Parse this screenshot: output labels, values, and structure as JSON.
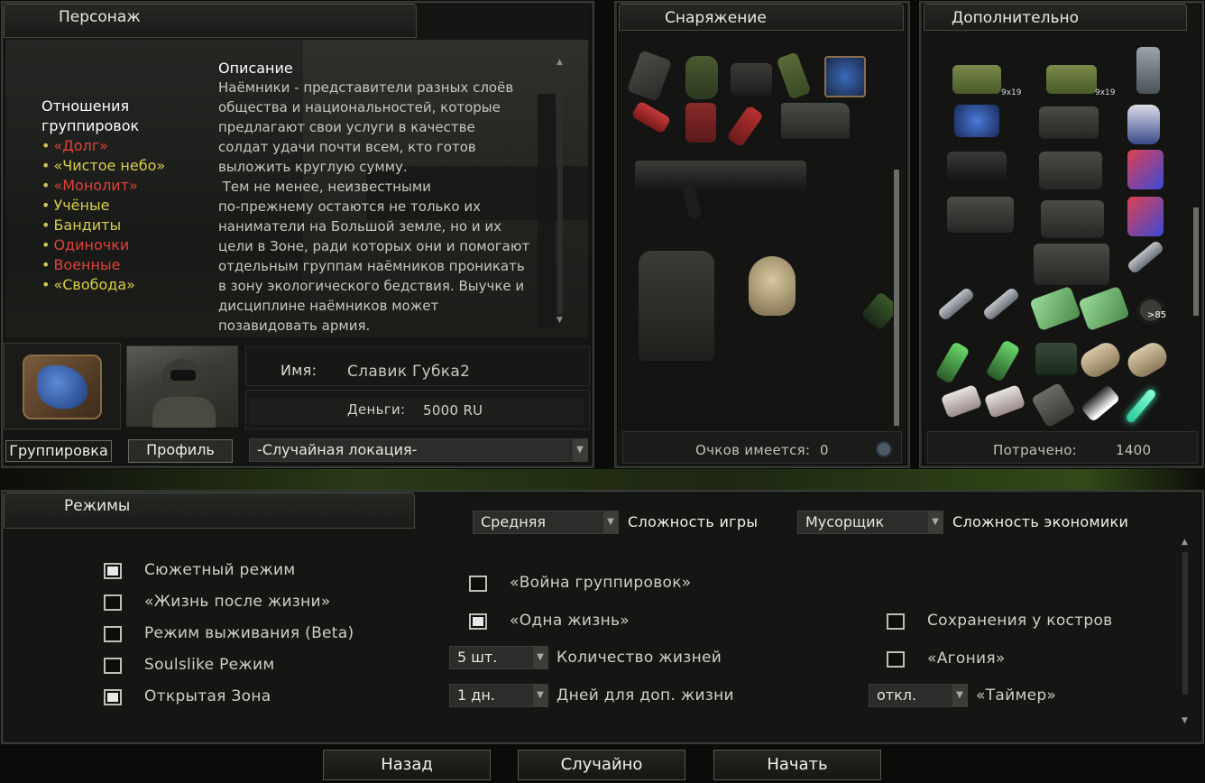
{
  "character": {
    "tab": "Персонаж",
    "relations_title": "Отношения группировок",
    "factions": [
      {
        "name": "«Долг»",
        "color": "#e0413a"
      },
      {
        "name": "«Чистое небо»",
        "color": "#d8cd48"
      },
      {
        "name": "«Монолит»",
        "color": "#e0413a"
      },
      {
        "name": "Учёные",
        "color": "#d8cd48"
      },
      {
        "name": "Бандиты",
        "color": "#d8cd48"
      },
      {
        "name": "Одиночки",
        "color": "#e0413a"
      },
      {
        "name": "Военные",
        "color": "#e0413a"
      },
      {
        "name": "«Свобода»",
        "color": "#d8cd48"
      }
    ],
    "description_title": "Описание",
    "description_lines": [
      "Наёмники - представители разных слоёв",
      "общества и национальностей, которые",
      "предлагают свои услуги в качестве",
      "солдат удачи почти всем, кто готов",
      "выложить круглую сумму.",
      " Тем не менее, неизвестными",
      "по-прежнему остаются не только их",
      "наниматели на Большой земле, но и их",
      "цели в Зоне, ради которых они и помогают",
      "отдельным группам наёмников проникать",
      "в зону экологического бедствия. Выучке и",
      "дисциплине наёмников может",
      "позавидовать армия."
    ],
    "name_label": "Имя:",
    "name_value": "Славик Губка2",
    "money_label": "Деньги:",
    "money_value": "5000 RU",
    "btn_faction": "Группировка",
    "btn_profile": "Профиль",
    "location": "-Случайная локация-"
  },
  "equipment": {
    "tab": "Снаряжение",
    "points_label": "Очков имеется:",
    "points_value": "0"
  },
  "extra": {
    "tab": "Дополнительно",
    "spent_label": "Потрачено:",
    "spent_value": "1400",
    "ammo_label": "9x19",
    "count_label": ">85"
  },
  "modes": {
    "tab": "Режимы",
    "difficulty_value": "Средняя",
    "difficulty_label": "Сложность игры",
    "economy_value": "Мусорщик",
    "economy_label": "Сложность экономики",
    "story_mode": {
      "label": "Сюжетный режим",
      "checked": true
    },
    "life_after": {
      "label": "«Жизнь после жизни»",
      "checked": false
    },
    "survival": {
      "label": "Режим выживания (Beta)",
      "checked": false
    },
    "soulslike": {
      "label": "Soulslike Режим",
      "checked": false
    },
    "open_zone": {
      "label": "Открытая Зона",
      "checked": true
    },
    "faction_war": {
      "label": "«Война группировок»",
      "checked": false
    },
    "one_life": {
      "label": "«Одна жизнь»",
      "checked": true
    },
    "lives_value": "5 шт.",
    "lives_label": "Количество жизней",
    "days_value": "1 дн.",
    "days_label": "Дней для доп. жизни",
    "campfire_save": {
      "label": "Сохранения у костров",
      "checked": false
    },
    "agony": {
      "label": "«Агония»",
      "checked": false
    },
    "timer_value": "откл.",
    "timer_label": "«Таймер»"
  },
  "buttons": {
    "back": "Назад",
    "random": "Случайно",
    "start": "Начать"
  },
  "colors": {
    "hostile": "#e0413a",
    "neutral": "#d8cd48"
  }
}
